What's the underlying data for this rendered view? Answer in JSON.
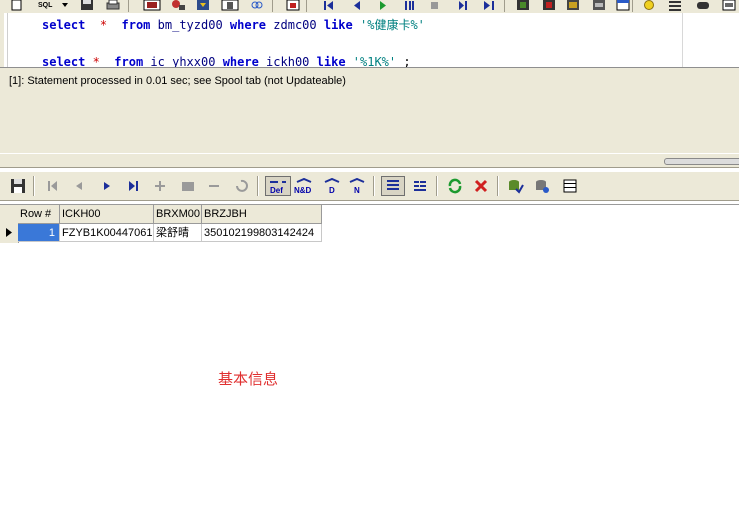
{
  "sql_editor": {
    "line1": {
      "kw1": "select",
      "op": "*",
      "kw2": "from",
      "table": "bm_tyzd00",
      "kw3": "where",
      "col": "zdmc00",
      "kw4": "like",
      "pattern": "'%健康卡%'"
    },
    "line2": {
      "kw1": "select",
      "op": "*",
      "kw2": "from",
      "table": "ic_yhxx00",
      "kw3": "where",
      "col": "ickh00",
      "kw4": "like",
      "pattern": "'%1K%'",
      "tail": ";"
    }
  },
  "messages": {
    "status": "[1]: Statement processed in 0.01 sec; see Spool tab (not Updateable)"
  },
  "grid_toolbar": {
    "def_label": "Def",
    "nd_label": "N&D",
    "d_label": "D",
    "n_label": "N"
  },
  "grid": {
    "columns": [
      "Row #",
      "ICKH00",
      "BRXM00",
      "BRZJBH"
    ],
    "rows": [
      {
        "row_num": "1",
        "ickh00": "FZYB1K00447061",
        "brxm00": "梁舒晴",
        "brzjbh": "350102199803142424"
      }
    ]
  },
  "annotation": {
    "text": "基本信息"
  },
  "colors": {
    "keyword": "#0000cc",
    "string": "#008080",
    "selected_row": "#3a78d8",
    "annotation": "#e03030",
    "panel_bg": "#ece9d8"
  }
}
